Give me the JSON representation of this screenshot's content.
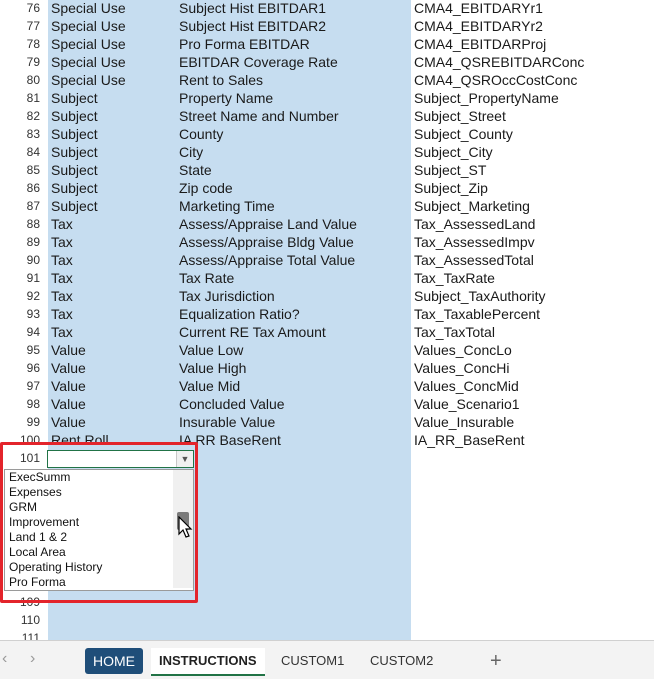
{
  "rows": [
    {
      "num": "76",
      "a": "Special Use",
      "b": "Subject Hist EBITDAR1",
      "c": "CMA4_EBITDARYr1"
    },
    {
      "num": "77",
      "a": "Special Use",
      "b": "Subject Hist EBITDAR2",
      "c": "CMA4_EBITDARYr2"
    },
    {
      "num": "78",
      "a": "Special Use",
      "b": "Pro Forma EBITDAR",
      "c": "CMA4_EBITDARProj"
    },
    {
      "num": "79",
      "a": "Special Use",
      "b": "EBITDAR Coverage Rate",
      "c": "CMA4_QSREBITDARConc"
    },
    {
      "num": "80",
      "a": "Special Use",
      "b": "Rent to Sales",
      "c": "CMA4_QSROccCostConc"
    },
    {
      "num": "81",
      "a": "Subject",
      "b": "Property Name",
      "c": "Subject_PropertyName"
    },
    {
      "num": "82",
      "a": "Subject",
      "b": "Street Name and Number",
      "c": "Subject_Street"
    },
    {
      "num": "83",
      "a": "Subject",
      "b": "County",
      "c": "Subject_County"
    },
    {
      "num": "84",
      "a": "Subject",
      "b": "City",
      "c": "Subject_City"
    },
    {
      "num": "85",
      "a": "Subject",
      "b": "State",
      "c": "Subject_ST"
    },
    {
      "num": "86",
      "a": "Subject",
      "b": "Zip code",
      "c": "Subject_Zip"
    },
    {
      "num": "87",
      "a": "Subject",
      "b": "Marketing Time",
      "c": "Subject_Marketing"
    },
    {
      "num": "88",
      "a": "Tax",
      "b": "Assess/Appraise Land Value",
      "c": "Tax_AssessedLand"
    },
    {
      "num": "89",
      "a": "Tax",
      "b": "Assess/Appraise Bldg Value",
      "c": "Tax_AssessedImpv"
    },
    {
      "num": "90",
      "a": "Tax",
      "b": "Assess/Appraise Total Value",
      "c": "Tax_AssessedTotal"
    },
    {
      "num": "91",
      "a": "Tax",
      "b": "Tax Rate",
      "c": "Tax_TaxRate"
    },
    {
      "num": "92",
      "a": "Tax",
      "b": "Tax Jurisdiction",
      "c": "Subject_TaxAuthority"
    },
    {
      "num": "93",
      "a": "Tax",
      "b": "Equalization Ratio?",
      "c": "Tax_TaxablePercent"
    },
    {
      "num": "94",
      "a": "Tax",
      "b": "Current RE Tax Amount",
      "c": "Tax_TaxTotal"
    },
    {
      "num": "95",
      "a": "Value",
      "b": "Value Low",
      "c": "Values_ConcLo"
    },
    {
      "num": "96",
      "a": "Value",
      "b": "Value High",
      "c": "Values_ConcHi"
    },
    {
      "num": "97",
      "a": "Value",
      "b": "Value Mid",
      "c": "Values_ConcMid"
    },
    {
      "num": "98",
      "a": "Value",
      "b": "Concluded Value",
      "c": "Value_Scenario1"
    },
    {
      "num": "99",
      "a": "Value",
      "b": "Insurable Value",
      "c": "Value_Insurable"
    },
    {
      "num": "100",
      "a": "Rent Roll",
      "b": "IA RR BaseRent",
      "c": "IA_RR_BaseRent"
    },
    {
      "num": "101",
      "a": "",
      "b": "",
      "c": ""
    }
  ],
  "lower_rows": [
    {
      "num": "109"
    },
    {
      "num": "110"
    },
    {
      "num": "111"
    }
  ],
  "dropdown": {
    "items": [
      "ExecSumm",
      "Expenses",
      "GRM",
      "Improvement",
      "Land 1 & 2",
      "Local Area",
      "Operating History",
      "Pro Forma"
    ],
    "arrow": "▼"
  },
  "tabs": {
    "prev": "‹",
    "next": "›",
    "home": "HOME",
    "instructions": "INSTRUCTIONS",
    "custom1": "CUSTOM1",
    "custom2": "CUSTOM2",
    "add": "+"
  }
}
